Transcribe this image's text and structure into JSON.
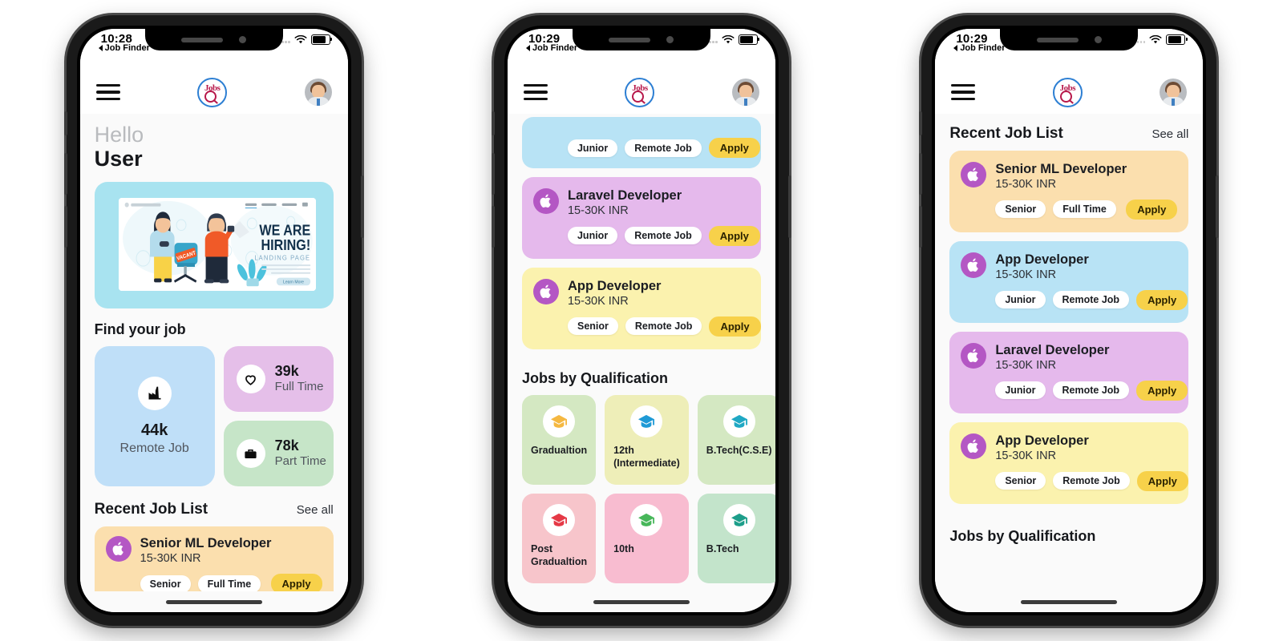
{
  "phones": [
    {
      "status": {
        "time": "10:28",
        "back_label": "Job Finder",
        "wifi_icon": "wifi-icon",
        "battery_icon": "battery-icon",
        "signal_icon": "signal-dots-icon"
      },
      "header": {
        "menu_icon": "hamburger-menu-icon",
        "logo_text": "Jobs",
        "logo_icon": "jobs-search-logo-icon",
        "avatar_icon": "user-avatar-icon"
      },
      "greeting": {
        "line1": "Hello",
        "line2": "User"
      },
      "banner": {
        "logo_text": "LOGO COMPANY",
        "nav": [
          "HOME",
          "ABOUT US",
          "CONTACT"
        ],
        "headline1": "WE ARE",
        "headline2": "HIRING!",
        "subhead": "LANDING PAGE",
        "cta": "Learn More",
        "chair_tag": "VACANT"
      },
      "find_title": "Find your job",
      "stats": [
        {
          "icon": "factory-icon",
          "value": "44k",
          "label": "Remote Job",
          "color": "#bfdff8"
        },
        {
          "icon": "heart-icon",
          "value": "39k",
          "label": "Full Time",
          "color": "#e5bfe9"
        },
        {
          "icon": "briefcase-icon",
          "value": "78k",
          "label": "Part Time",
          "color": "#c6e5c8"
        }
      ],
      "recent": {
        "title": "Recent Job List",
        "see_all": "See all"
      },
      "jobs": [
        {
          "title": "Senior ML Developer",
          "salary": "15-30K INR",
          "chips": [
            "Senior",
            "Full Time"
          ],
          "apply": "Apply",
          "color": "#fbdfae",
          "logo_icon": "apple-logo-icon"
        }
      ]
    },
    {
      "status": {
        "time": "10:29",
        "back_label": "Job Finder",
        "wifi_icon": "wifi-icon",
        "battery_icon": "battery-icon",
        "signal_icon": "signal-dots-icon"
      },
      "header": {
        "menu_icon": "hamburger-menu-icon",
        "logo_text": "Jobs",
        "logo_icon": "jobs-search-logo-icon",
        "avatar_icon": "user-avatar-icon"
      },
      "partial_job": {
        "chips": [
          "Junior",
          "Remote Job"
        ],
        "apply": "Apply",
        "color": "#b8e3f5"
      },
      "jobs": [
        {
          "title": "Laravel Developer",
          "salary": "15-30K INR",
          "chips": [
            "Junior",
            "Remote Job"
          ],
          "apply": "Apply",
          "color": "#e5b9ec",
          "logo_icon": "apple-logo-icon"
        },
        {
          "title": "App Developer",
          "salary": "15-30K INR",
          "chips": [
            "Senior",
            "Remote Job"
          ],
          "apply": "Apply",
          "color": "#fbf2ae",
          "logo_icon": "apple-logo-icon"
        }
      ],
      "qual_title": "Jobs by Qualification",
      "qualifications": [
        {
          "name": "Gradualtion",
          "color": "#d4e8c2",
          "cap_color": "#f5b841",
          "icon": "graduation-cap-icon"
        },
        {
          "name": "12th    (Intermediate)",
          "color": "#eeeeb8",
          "cap_color": "#1f9ad6",
          "icon": "graduation-cap-icon"
        },
        {
          "name": "B.Tech(C.S.E)",
          "color": "#d4e8c2",
          "cap_color": "#1fa8c4",
          "icon": "graduation-cap-icon"
        },
        {
          "name": "Post Gradualtion",
          "color": "#f7c5cb",
          "cap_color": "#e53946",
          "icon": "graduation-cap-icon"
        },
        {
          "name": "10th",
          "color": "#f8bcd0",
          "cap_color": "#47b75a",
          "icon": "graduation-cap-icon"
        },
        {
          "name": "B.Tech",
          "color": "#c3e4cb",
          "cap_color": "#1d9e8a",
          "icon": "graduation-cap-icon"
        }
      ]
    },
    {
      "status": {
        "time": "10:29",
        "back_label": "Job Finder",
        "wifi_icon": "wifi-icon",
        "battery_icon": "battery-icon",
        "signal_icon": "signal-dots-icon"
      },
      "header": {
        "menu_icon": "hamburger-menu-icon",
        "logo_text": "Jobs",
        "logo_icon": "jobs-search-logo-icon",
        "avatar_icon": "user-avatar-icon"
      },
      "recent": {
        "title": "Recent Job List",
        "see_all": "See all"
      },
      "jobs": [
        {
          "title": "Senior ML Developer",
          "salary": "15-30K INR",
          "chips": [
            "Senior",
            "Full Time"
          ],
          "apply": "Apply",
          "color": "#fbdfae",
          "logo_icon": "apple-logo-icon"
        },
        {
          "title": "App Developer",
          "salary": "15-30K INR",
          "chips": [
            "Junior",
            "Remote Job"
          ],
          "apply": "Apply",
          "color": "#b8e3f5",
          "logo_icon": "apple-logo-icon"
        },
        {
          "title": "Laravel Developer",
          "salary": "15-30K INR",
          "chips": [
            "Junior",
            "Remote Job"
          ],
          "apply": "Apply",
          "color": "#e5b9ec",
          "logo_icon": "apple-logo-icon"
        },
        {
          "title": "App Developer",
          "salary": "15-30K INR",
          "chips": [
            "Senior",
            "Remote Job"
          ],
          "apply": "Apply",
          "color": "#fbf2ae",
          "logo_icon": "apple-logo-icon"
        }
      ],
      "qual_title": "Jobs by Qualification"
    }
  ],
  "colors": {
    "accent_yellow": "#f7d14a",
    "logo_blue": "#2d7fd3",
    "logo_red": "#b7184a",
    "job_logo_purple": "#b457c4",
    "screen_bg": "#fafafa"
  }
}
